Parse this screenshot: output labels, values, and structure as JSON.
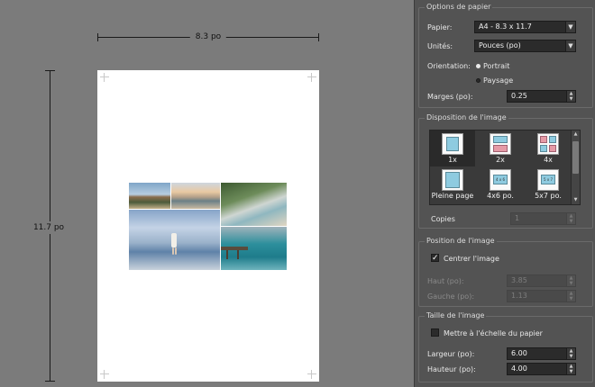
{
  "preview": {
    "width_label": "8.3 po",
    "height_label": "11.7 po"
  },
  "paper_options": {
    "title": "Options de papier",
    "paper_label": "Papier:",
    "paper_value": "A4 - 8.3 x 11.7",
    "units_label": "Unités:",
    "units_value": "Pouces (po)",
    "orientation_label": "Orientation:",
    "orientation_options": [
      "Portrait",
      "Paysage"
    ],
    "orientation_selected": "Portrait",
    "margins_label": "Marges (po):",
    "margins_value": "0.25"
  },
  "layout": {
    "title": "Disposition de l'image",
    "tiles": [
      {
        "label": "1x",
        "icon": "layout-1x-icon"
      },
      {
        "label": "2x",
        "icon": "layout-2x-icon"
      },
      {
        "label": "4x",
        "icon": "layout-4x-icon"
      },
      {
        "label": "Pleine page",
        "icon": "layout-full-page-icon"
      },
      {
        "label": "4x6 po.",
        "icon": "layout-4x6-icon"
      },
      {
        "label": "5x7 po.",
        "icon": "layout-5x7-icon"
      }
    ],
    "selected": "1x",
    "tile_badges": {
      "t4x6": "4 x 6",
      "t5x7": "5 x 7"
    },
    "copies_label": "Copies",
    "copies_value": "1"
  },
  "position": {
    "title": "Position de l'image",
    "center_label": "Centrer l'image",
    "center_checked": true,
    "top_label": "Haut (po):",
    "top_value": "3.85",
    "left_label": "Gauche (po):",
    "left_value": "1.13"
  },
  "size": {
    "title": "Taille de l'image",
    "fit_label": "Mettre à l'échelle du papier",
    "fit_checked": false,
    "width_label": "Largeur (po):",
    "width_value": "6.00",
    "height_label": "Hauteur (po):",
    "height_value": "4.00"
  },
  "colors": {
    "panel": "#535353",
    "preview_bg": "#7b7b7b",
    "paper": "#ffffff",
    "thumb_blue": "#8ecbe0",
    "thumb_pink": "#e59aa6"
  }
}
